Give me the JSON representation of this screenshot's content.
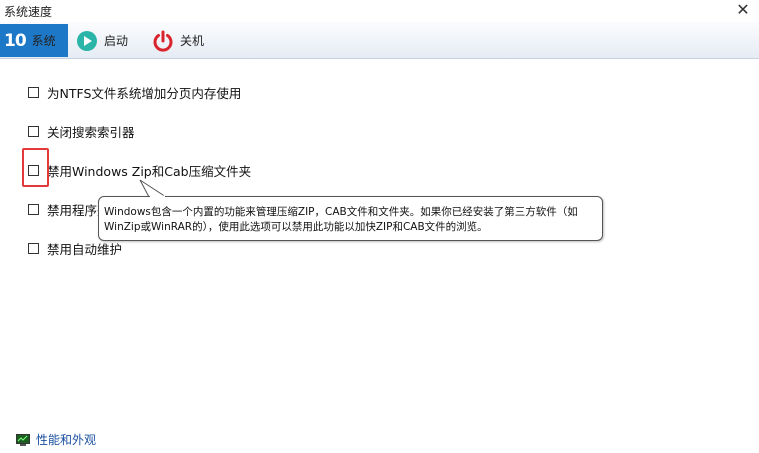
{
  "window": {
    "title": "系统速度",
    "close_glyph": "✕"
  },
  "tabs": [
    {
      "label": "系统",
      "badge": "10",
      "icon": "windows10-icon",
      "active": true
    },
    {
      "label": "启动",
      "icon": "play-icon",
      "active": false
    },
    {
      "label": "关机",
      "icon": "power-icon",
      "active": false
    }
  ],
  "options": [
    {
      "label": "为NTFS文件系统增加分页内存使用",
      "checked": false
    },
    {
      "label": "关闭搜索索引器",
      "checked": false
    },
    {
      "label": "禁用Windows Zip和Cab压缩文件夹",
      "checked": false
    },
    {
      "label": "禁用程序兼容性助手",
      "checked": false
    },
    {
      "label": "禁用自动维护",
      "checked": false
    }
  ],
  "tooltip": {
    "text": "Windows包含一个内置的功能来管理压缩ZIP，CAB文件和文件夹。如果你已经安装了第三方软件（如WinZip或WinRAR的），使用此选项可以禁用此功能以加快ZIP和CAB文件的浏览。"
  },
  "footer": {
    "link_label": "性能和外观",
    "icon": "performance-icon"
  },
  "colors": {
    "accent": "#1e78c8",
    "highlight": "#e23a3a",
    "link": "#1a4fa0",
    "boot_icon": "#2bb5a8",
    "power_icon": "#d9232d"
  }
}
